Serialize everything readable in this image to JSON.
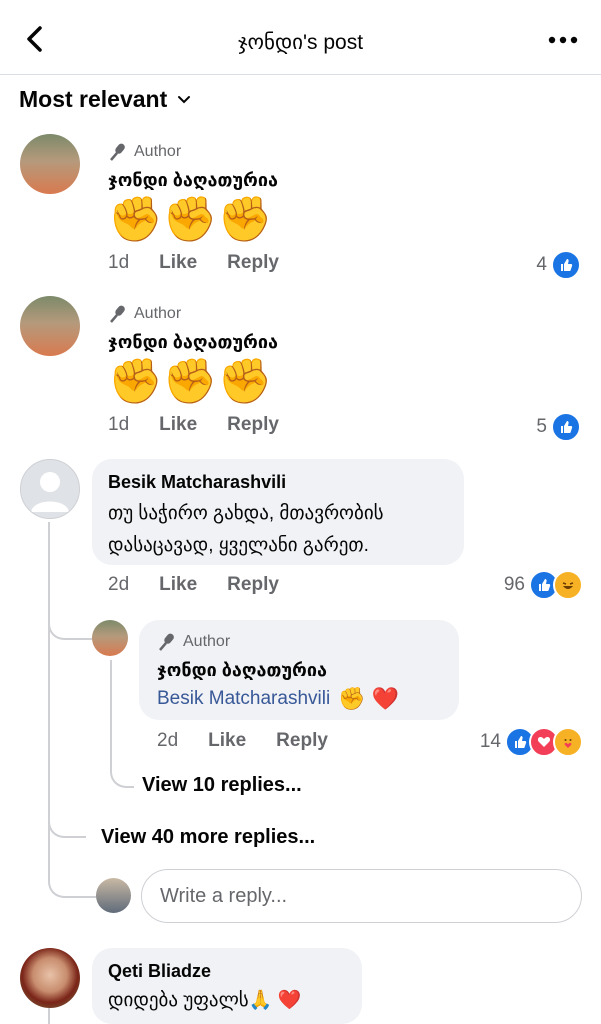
{
  "header": {
    "title": "ჯონდი's post"
  },
  "sort": {
    "label": "Most relevant"
  },
  "comments": [
    {
      "author_badge": "Author",
      "name": "ჯონდი ბაღათურია",
      "emoji": "✊✊✊",
      "time": "1d",
      "like": "Like",
      "reply": "Reply",
      "count": "4"
    },
    {
      "author_badge": "Author",
      "name": "ჯონდი ბაღათურია",
      "emoji": "✊✊✊",
      "time": "1d",
      "like": "Like",
      "reply": "Reply",
      "count": "5"
    },
    {
      "name": "Besik Matcharashvili",
      "text_line1": "თუ საჭირო გახდა, მთავრობის",
      "text_line2": "დასაცავად, ყველანი გარეთ.",
      "time": "2d",
      "like": "Like",
      "reply": "Reply",
      "count": "96"
    }
  ],
  "reply": {
    "author_badge": "Author",
    "name": "ჯონდი ბაღათურია",
    "mention": "Besik Matcharashvili",
    "emoji": "✊ ❤️",
    "time": "2d",
    "like": "Like",
    "reply": "Reply",
    "count": "14"
  },
  "view_replies": "View 10 replies...",
  "view_more": "View 40 more replies...",
  "reply_input": {
    "placeholder": "Write a reply..."
  },
  "comment4": {
    "name": "Qeti Bliadze",
    "text": "დიდება უფალს🙏 ❤️"
  }
}
